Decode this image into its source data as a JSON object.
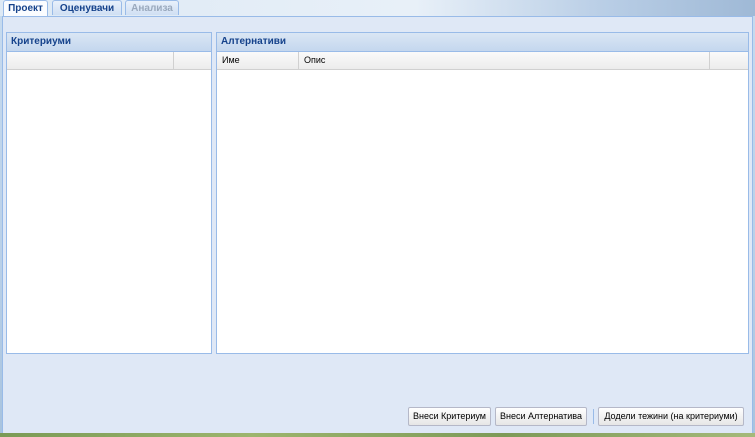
{
  "tabs": [
    {
      "label": "Проект",
      "state": "active"
    },
    {
      "label": "Оценувачи",
      "state": "normal"
    },
    {
      "label": "Анализа",
      "state": "disabled"
    }
  ],
  "criteria_panel": {
    "title": "Критериуми"
  },
  "alternatives_panel": {
    "title": "Алтернативи",
    "columns": [
      "Име",
      "Опис"
    ]
  },
  "buttons": {
    "add_criterion": "Внеси Критериум",
    "add_alternative": "Внеси Алтернатива",
    "assign_weights": "Додели тежини (на критериуми)"
  },
  "colors": {
    "header_text": "#15428b",
    "panel_border": "#99bbe8",
    "panel_background": "#dfe8f6"
  }
}
